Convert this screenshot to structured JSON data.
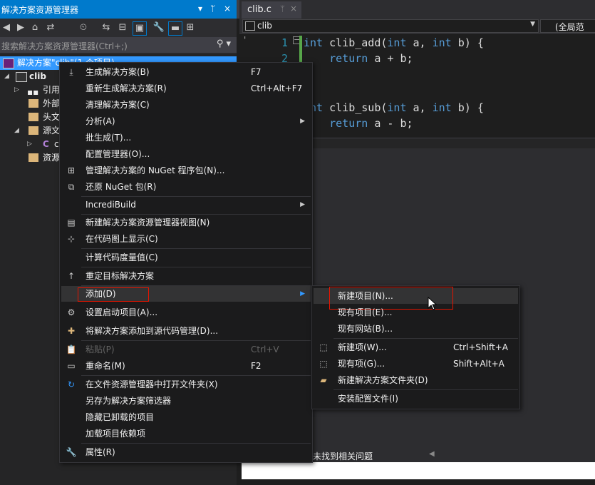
{
  "solution_explorer": {
    "title": "解决方案资源管理器",
    "pin_glyph": "▾ ⊥",
    "close_glyph": "×",
    "search_placeholder": "搜索解决方案资源管理器(Ctrl+;)",
    "tree": [
      {
        "label": "解决方案\"clib\"(1 个项目)"
      },
      {
        "label": "clib"
      },
      {
        "label": "引用"
      },
      {
        "label": "外部"
      },
      {
        "label": "头文"
      },
      {
        "label": "源文"
      },
      {
        "label": "c"
      },
      {
        "label": "资源"
      }
    ]
  },
  "editor": {
    "tab_label": "clib.c",
    "nav_left": "clib",
    "nav_right": "(全局范围)",
    "lines": [
      {
        "num": "1",
        "tokens": [
          "int",
          " clib_add(",
          "int",
          " a, ",
          "int",
          " b) {"
        ]
      },
      {
        "num": "2",
        "text": "    return a + b;"
      },
      {
        "num": "",
        "text": ""
      },
      {
        "num": "",
        "text": ""
      },
      {
        "num": "",
        "tokens": [
          "int",
          " clib_sub(",
          "int",
          " a, ",
          "int",
          " b) {"
        ]
      },
      {
        "num": "",
        "text": "    return a - b;"
      }
    ],
    "status_message": "未找到相关问题"
  },
  "context_menu": {
    "items": [
      {
        "label": "生成解决方案(B)",
        "shortcut": "F7",
        "icon": "build-icon"
      },
      {
        "label": "重新生成解决方案(R)",
        "shortcut": "Ctrl+Alt+F7"
      },
      {
        "label": "清理解决方案(C)"
      },
      {
        "label": "分析(A)",
        "submenu": true
      },
      {
        "label": "批生成(T)..."
      },
      {
        "label": "配置管理器(O)..."
      },
      {
        "label": "管理解决方案的 NuGet 程序包(N)...",
        "icon": "nuget-icon"
      },
      {
        "label": "还原 NuGet 包(R)",
        "icon": "restore-icon"
      },
      {
        "label": "IncrediBuild",
        "submenu": true
      },
      {
        "label": "新建解决方案资源管理器视图(N)",
        "icon": "new-view-icon"
      },
      {
        "label": "在代码图上显示(C)",
        "icon": "code-map-icon"
      },
      {
        "label": "计算代码度量值(C)"
      },
      {
        "label": "重定目标解决方案",
        "icon": "retarget-icon"
      },
      {
        "label": "添加(D)",
        "submenu": true
      },
      {
        "label": "设置启动项目(A)...",
        "icon": "gear-icon"
      },
      {
        "label": "将解决方案添加到源代码管理(D)...",
        "icon": "source-control-icon"
      },
      {
        "label": "粘贴(P)",
        "shortcut": "Ctrl+V",
        "disabled": true,
        "icon": "paste-icon"
      },
      {
        "label": "重命名(M)",
        "shortcut": "F2",
        "icon": "rename-icon"
      },
      {
        "label": "在文件资源管理器中打开文件夹(X)",
        "icon": "open-folder-icon"
      },
      {
        "label": "另存为解决方案筛选器"
      },
      {
        "label": "隐藏已卸载的项目"
      },
      {
        "label": "加载项目依赖项"
      },
      {
        "label": "属性(R)",
        "icon": "wrench-icon"
      }
    ]
  },
  "add_submenu": {
    "items": [
      {
        "label": "新建项目(N)..."
      },
      {
        "label": "现有项目(E)..."
      },
      {
        "label": "现有网站(B)..."
      },
      {
        "label": "新建项(W)...",
        "shortcut": "Ctrl+Shift+A",
        "icon": "new-item-icon"
      },
      {
        "label": "现有项(G)...",
        "shortcut": "Shift+Alt+A",
        "icon": "existing-item-icon"
      },
      {
        "label": "新建解决方案文件夹(D)",
        "icon": "new-folder-icon"
      },
      {
        "label": "安装配置文件(I)"
      }
    ]
  },
  "colors": {
    "accent": "#007acc",
    "selection": "#3399ff",
    "highlight_box": "#e51400",
    "keyword": "#569cd6"
  }
}
